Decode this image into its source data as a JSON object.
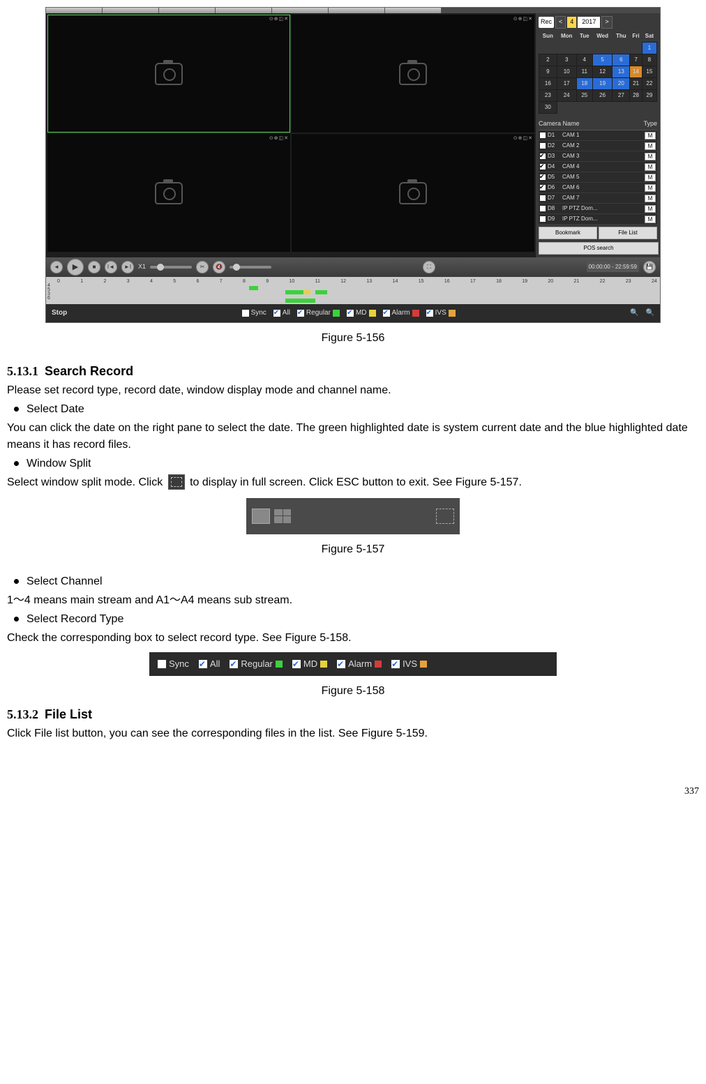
{
  "screenshot": {
    "rec_label": "Rec",
    "month": "4",
    "year": "2017",
    "weekdays": [
      "Sun",
      "Mon",
      "Tue",
      "Wed",
      "Thu",
      "Fri",
      "Sat"
    ],
    "cal_rows": [
      [
        "",
        "",
        "",
        "",
        "",
        "",
        "1"
      ],
      [
        "2",
        "3",
        "4",
        "5",
        "6",
        "7",
        "8"
      ],
      [
        "9",
        "10",
        "11",
        "12",
        "13",
        "14",
        "15"
      ],
      [
        "16",
        "17",
        "18",
        "19",
        "20",
        "21",
        "22"
      ],
      [
        "23",
        "24",
        "25",
        "26",
        "27",
        "28",
        "29"
      ],
      [
        "30",
        "",
        "",
        "",
        "",
        "",
        ""
      ]
    ],
    "cam_header_name": "Camera Name",
    "cam_header_type": "Type",
    "cameras": [
      {
        "chk": false,
        "id": "D1",
        "name": "CAM 1",
        "type": "M"
      },
      {
        "chk": false,
        "id": "D2",
        "name": "CAM 2",
        "type": "M"
      },
      {
        "chk": true,
        "id": "D3",
        "name": "CAM 3",
        "type": "M"
      },
      {
        "chk": true,
        "id": "D4",
        "name": "CAM 4",
        "type": "M"
      },
      {
        "chk": true,
        "id": "D5",
        "name": "CAM 5",
        "type": "M"
      },
      {
        "chk": true,
        "id": "D6",
        "name": "CAM 6",
        "type": "M"
      },
      {
        "chk": false,
        "id": "D7",
        "name": "CAM 7",
        "type": "M"
      },
      {
        "chk": false,
        "id": "D8",
        "name": "IP PTZ Dom...",
        "type": "M"
      },
      {
        "chk": false,
        "id": "D9",
        "name": "IP PTZ Dom...",
        "type": "M"
      }
    ],
    "bookmark": "Bookmark",
    "filelist": "File List",
    "possearch": "POS search",
    "speed": "X1",
    "timestamp": "00:00:00 - 22:59:59",
    "timeline_hours": [
      "0",
      "1",
      "2",
      "3",
      "4",
      "5",
      "6",
      "7",
      "8",
      "9",
      "10",
      "11",
      "12",
      "13",
      "14",
      "15",
      "16",
      "17",
      "18",
      "19",
      "20",
      "21",
      "22",
      "23",
      "24"
    ],
    "tl_labels": [
      "4",
      "5",
      "3",
      "6"
    ],
    "stop": "Stop",
    "checks": {
      "sync": "Sync",
      "all": "All",
      "regular": "Regular",
      "md": "MD",
      "alarm": "Alarm",
      "ivs": "IVS"
    }
  },
  "fig156": "Figure 5-156",
  "sec1_num": "5.13.1",
  "sec1_title": "Search Record",
  "sec1_intro": "Please set record type, record date, window display mode and channel name.",
  "bul_select_date": "Select Date",
  "sec1_date_desc": "You can click the date on the right pane to select the date. The green highlighted date is system current date and the blue highlighted date means it has record files.",
  "bul_window_split": "Window Split",
  "sec1_split_a": "Select window split mode. Click ",
  "sec1_split_b": " to display in full screen. Click ESC button to exit. See Figure 5-157.",
  "fig157": "Figure 5-157",
  "bul_select_channel": "Select Channel",
  "channel_desc": "1～4  means main stream and A1～A4 means sub stream.",
  "bul_select_rectype": "Select Record Type",
  "rectype_desc": "Check the corresponding box to select record type. See Figure 5-158.",
  "fig158_labels": {
    "sync": "Sync",
    "all": "All",
    "regular": "Regular",
    "md": "MD",
    "alarm": "Alarm",
    "ivs": "IVS"
  },
  "fig158": "Figure 5-158",
  "sec2_num": "5.13.2",
  "sec2_title": "File List",
  "sec2_desc": "Click File list button, you can see the corresponding files in the list. See Figure 5-159.",
  "page_no": "337"
}
